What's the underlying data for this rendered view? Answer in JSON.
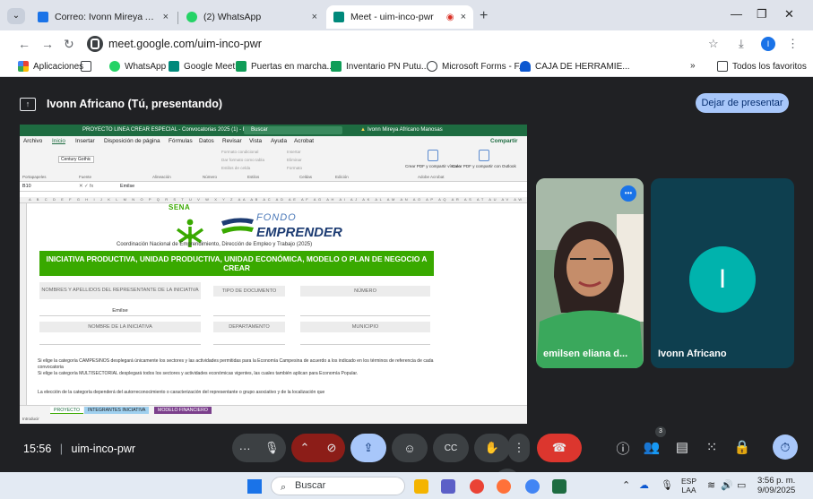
{
  "browser": {
    "tabs": [
      {
        "label": "Correo: Ivonn Mireya Africano",
        "close": "×"
      },
      {
        "label": "(2) WhatsApp",
        "close": "×"
      },
      {
        "label": "Meet - uim-inco-pwr",
        "close": "×"
      }
    ],
    "url": "meet.google.com/uim-inco-pwr",
    "profile_initial": "I",
    "bookmarks": [
      "Aplicaciones",
      "WhatsApp",
      "Google Meet",
      "Puertas en marcha...",
      "Inventario PN Putu...",
      "Microsoft Forms - F...",
      "CAJA DE HERRAMIE..."
    ],
    "all_bookmarks": "Todos los favoritos"
  },
  "meet": {
    "presenter_label": "Ivonn Africano (Tú, presentando)",
    "stop_presenting": "Dejar de presentar",
    "time": "15:56",
    "meeting_code": "uim-inco-pwr",
    "participant_count": "3",
    "participants": [
      {
        "name": "emilsen eliana d..."
      },
      {
        "name": "Ivonn Africano",
        "initial": "I"
      }
    ]
  },
  "excel": {
    "window_title": "PROYECTO LINEA CREAR ESPECIAL - Convocatorias 2025 (1) - Ex...",
    "search": "Buscar",
    "user": "Ivonn Mireya Africano Manosas",
    "menu": [
      "Archivo",
      "Inicio",
      "Insertar",
      "Disposición de página",
      "Fórmulas",
      "Datos",
      "Revisar",
      "Vista",
      "Ayuda",
      "Acrobat"
    ],
    "share": "Compartir",
    "font_name": "Century Gothic",
    "ribbon_groups": [
      "Portapapeles",
      "Fuente",
      "Alineación",
      "Número",
      "Estilos",
      "Celdas",
      "Edición",
      "Adobe Acrobat"
    ],
    "ribbon_items": [
      "Formato condicional",
      "Dar formato como tabla",
      "Estilos de celda",
      "Insertar",
      "Eliminar",
      "Formato"
    ],
    "pdf_buttons": [
      "Crear PDF y compartir vínculo",
      "Crear PDF y compartir con Outlook"
    ],
    "cell_ref": "B10",
    "formula_value": "Emilse",
    "sena_text": "SENA",
    "fondo": "FONDO",
    "emprender": "EMPRENDER",
    "coordination": "Coordinación Nacional de Emprendimiento, Dirección de Empleo y Trabajo (2025)",
    "banner": "INICIATIVA PRODUCTIVA, UNIDAD PRODUCTIVA, UNIDAD ECONÓMICA, MODELO O PLAN DE NEGOCIO A CREAR",
    "fields": {
      "representante": "NOMBRES Y APELLIDOS DEL REPRESENTANTE DE LA INICIATIVA",
      "tipo_documento": "TIPO DE DOCUMENTO",
      "numero": "NÚMERO",
      "representante_value": "Emilse",
      "nombre_iniciativa": "NOMBRE DE LA INICIATIVA",
      "departamento": "DEPARTAMENTO",
      "municipio": "MUNICIPIO"
    },
    "paragraphs": [
      "Si elige la categoría CAMPESINOS desplegará únicamente los sectores y las actividades permitidas para la Economía Campesina de acuerdo a los indicado en los términos de referencia de cada convocatoria",
      "Si elige la categoría MULTISECTORIAL desplegará todos los sectores y actividades económicas vigentes, las cuales también aplican para Economía Popular.",
      "La elección de la categoría dependerá del autorreconocimiento o caracterización del representante o grupo asociativo y de la localización que"
    ],
    "sheet_tabs": [
      "PROYECTO",
      "INTEGRANTES INICIATIVA",
      "MODELO FINANCIERO"
    ],
    "status": "Introducir"
  },
  "taskbar": {
    "search": "Buscar",
    "lang_top": "ESP",
    "lang_bottom": "LAA",
    "time": "3:56 p. m.",
    "date": "9/09/2025"
  },
  "colors": {
    "sena_green": "#39a900",
    "meet_blue": "#a8c7fa",
    "hangup_red": "#dc362e",
    "excel_green": "#1e6c41"
  }
}
